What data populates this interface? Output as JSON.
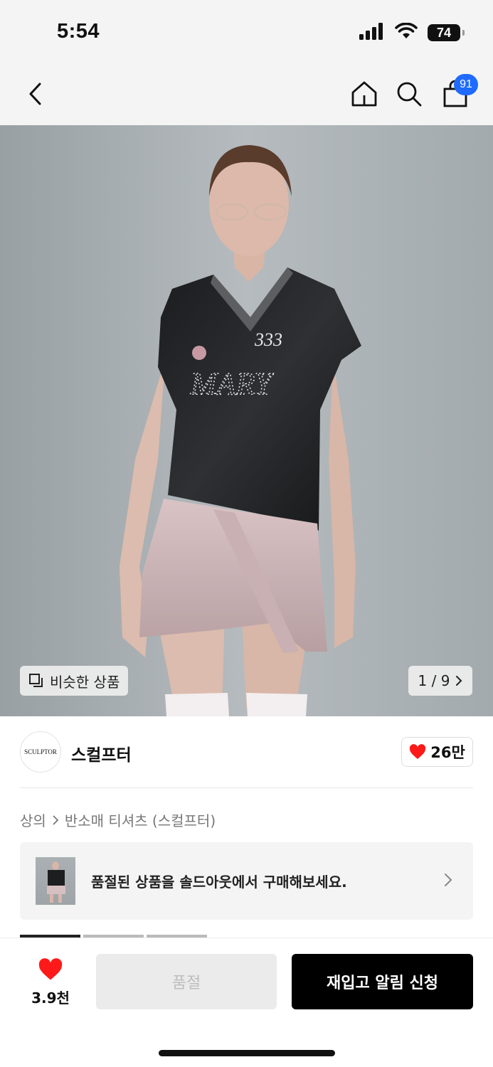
{
  "status_bar": {
    "time": "5:54",
    "battery": "74",
    "icons": [
      "signal-icon",
      "wifi-icon",
      "battery-icon"
    ]
  },
  "nav": {
    "icons": [
      "back-arrow-icon",
      "home-icon",
      "search-icon",
      "shopping-bag-icon"
    ],
    "cart_count": "91"
  },
  "hero": {
    "similar_products_label": "비슷한 상품",
    "image_counter": "1 / 9",
    "shirt_text_top": "333",
    "shirt_text_main": "MARY"
  },
  "brand": {
    "logo_text": "SCULPTOR",
    "name": "스컬프터",
    "likes": "26만"
  },
  "breadcrumb": {
    "category": "상의",
    "subcategory": "반소매 티셔츠 (스컬프터)"
  },
  "soldout_banner": {
    "text": "품절된 상품을 솔드아웃에서 구매해보세요."
  },
  "bottom_bar": {
    "wish_count": "3.9천",
    "soldout_label": "품절",
    "restock_label": "재입고 알림 신청"
  },
  "colors": {
    "accent_blue": "#1f6bff",
    "heart_red": "#ff1a1a",
    "cta_black": "#000000"
  }
}
